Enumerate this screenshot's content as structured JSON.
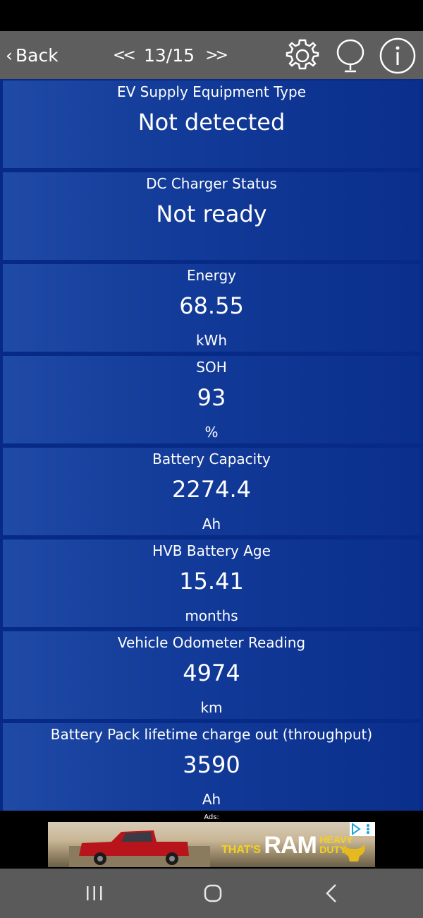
{
  "toolbar": {
    "back_label": "Back",
    "prev_label": "<<",
    "page_indicator": "13/15",
    "next_label": ">>",
    "icons": [
      "gear-icon",
      "microphone-icon",
      "info-icon"
    ]
  },
  "cards": [
    {
      "label": "EV Supply Equipment Type",
      "value": "Not detected",
      "unit": ""
    },
    {
      "label": "DC Charger Status",
      "value": "Not ready",
      "unit": ""
    },
    {
      "label": "Energy",
      "value": "68.55",
      "unit": "kWh"
    },
    {
      "label": "SOH",
      "value": "93",
      "unit": "%"
    },
    {
      "label": "Battery Capacity",
      "value": "2274.4",
      "unit": "Ah"
    },
    {
      "label": "HVB Battery Age",
      "value": "15.41",
      "unit": "months"
    },
    {
      "label": "Vehicle Odometer Reading",
      "value": "4974",
      "unit": "km"
    },
    {
      "label": "Battery Pack lifetime charge out (throughput)",
      "value": "3590",
      "unit": "Ah"
    }
  ],
  "ad": {
    "label": "Ads:",
    "text_small": "THAT'S",
    "text_big": "RAM",
    "text_heavy": "HEAVY",
    "text_duty": "DUTY"
  },
  "colors": {
    "toolbar": "#5e5e5e",
    "card_bg": "#123a98",
    "content_bg": "#062a85"
  }
}
